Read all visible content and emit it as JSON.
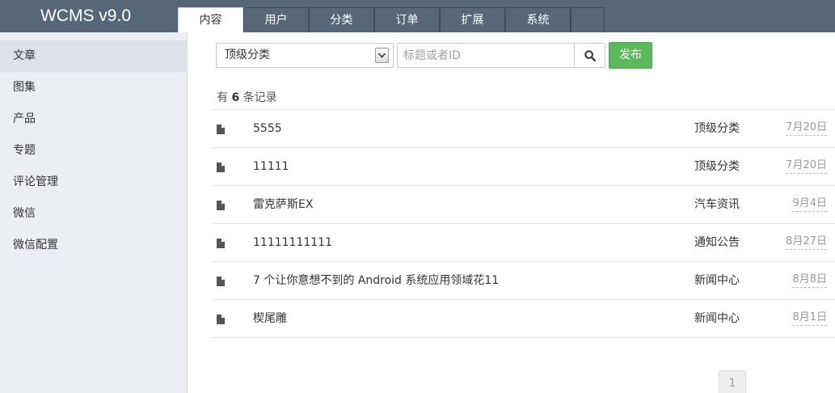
{
  "brand": "WCMS v9.0",
  "tabs": [
    "内容",
    "用户",
    "分类",
    "订单",
    "扩展",
    "系统",
    ""
  ],
  "active_tab": 0,
  "sidebar": {
    "items": [
      "文章",
      "图集",
      "产品",
      "专题",
      "评论管理",
      "微信",
      "微信配置"
    ],
    "active": 0
  },
  "toolbar": {
    "category_selected": "顶级分类",
    "search_placeholder": "标题或者ID",
    "search_value": "",
    "publish_label": "发布"
  },
  "record_count": {
    "prefix": "有",
    "count": "6",
    "suffix": "条记录"
  },
  "articles": [
    {
      "title": "5555",
      "category": "顶级分类",
      "date": "7月20日"
    },
    {
      "title": "11111",
      "category": "顶级分类",
      "date": "7月20日"
    },
    {
      "title": "雷克萨斯EX",
      "category": "汽车资讯",
      "date": "9月4日"
    },
    {
      "title": "11111111111",
      "category": "通知公告",
      "date": "8月27日"
    },
    {
      "title": "7 个让你意想不到的 Android 系统应用领域花11",
      "category": "新闻中心",
      "date": "8月8日"
    },
    {
      "title": "楔尾雕",
      "category": "新闻中心",
      "date": "8月1日"
    }
  ],
  "pagination": {
    "current": "1"
  },
  "icons": {
    "row": "document-icon",
    "search": "search-icon",
    "select": "chevron-down-icon"
  },
  "colors": {
    "topbar": "#56677a",
    "sidebar": "#ebeef2",
    "publish": "#5cb85c"
  }
}
